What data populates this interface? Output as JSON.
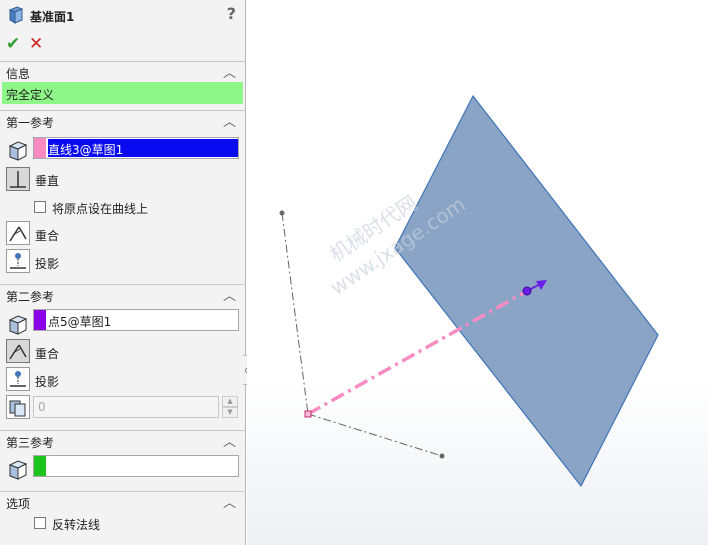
{
  "dialog": {
    "title": "基准面1",
    "help": "?",
    "ok": "✔",
    "cancel": "✕"
  },
  "info": {
    "header": "信息",
    "status": "完全定义",
    "status_color": "#8ef788"
  },
  "first_ref": {
    "header": "第一参考",
    "value": "直线3@草图1",
    "swatch_color": "#f78bc2",
    "options": [
      {
        "label": "垂直",
        "selected": true
      },
      {
        "label": "重合",
        "selected": false
      },
      {
        "label": "投影",
        "selected": false
      }
    ],
    "checkbox_label": "将原点设在曲线上"
  },
  "second_ref": {
    "header": "第二参考",
    "value": "点5@草图1",
    "swatch_color": "#8a00e6",
    "options": [
      {
        "label": "重合",
        "selected": true
      },
      {
        "label": "投影",
        "selected": false
      }
    ],
    "count_value": "0"
  },
  "third_ref": {
    "header": "第三参考",
    "value": "",
    "swatch_color": "#1ec41e"
  },
  "options": {
    "header": "选项",
    "flip_normal_label": "反转法线"
  },
  "watermark": {
    "line1": "机械时代网",
    "line2": "www.jxage.com"
  },
  "colors": {
    "plane_fill": "#8aa4c6",
    "plane_stroke": "#3f74b8",
    "normal_line": "#f78bc2",
    "arrow": "#6a1ee6"
  }
}
